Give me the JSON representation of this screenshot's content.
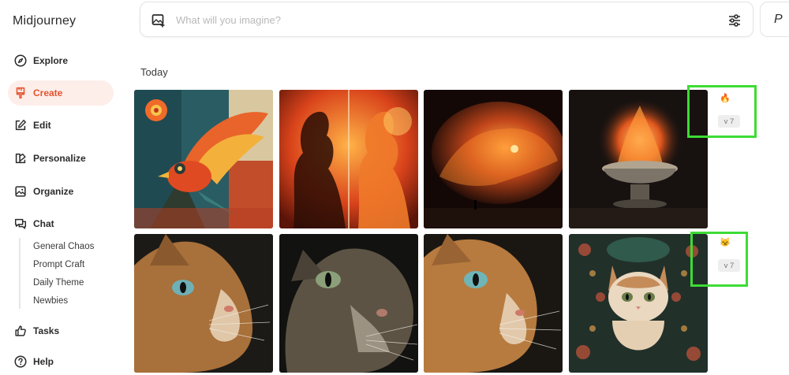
{
  "app": {
    "name": "Midjourney"
  },
  "sidebar": {
    "items": [
      {
        "label": "Explore",
        "icon": "compass-icon"
      },
      {
        "label": "Create",
        "icon": "brush-icon",
        "active": true
      },
      {
        "label": "Edit",
        "icon": "edit-icon"
      },
      {
        "label": "Personalize",
        "icon": "personalize-icon"
      },
      {
        "label": "Organize",
        "icon": "image-icon"
      },
      {
        "label": "Chat",
        "icon": "chat-icon"
      },
      {
        "label": "Tasks",
        "icon": "thumbs-up-icon"
      },
      {
        "label": "Help",
        "icon": "help-icon"
      }
    ],
    "chat_channels": [
      "General Chaos",
      "Prompt Craft",
      "Daily Theme",
      "Newbies"
    ]
  },
  "search": {
    "placeholder": "What will you imagine?"
  },
  "profile": {
    "label": "P"
  },
  "feed": {
    "section_title": "Today",
    "rows": [
      {
        "emoji": "🔥",
        "version": "v 7",
        "images": [
          "phoenix-bird-art",
          "woman-fire-silhouette",
          "fire-wolf-cloud",
          "fire-bowl"
        ]
      },
      {
        "emoji": "😼",
        "version": "v 7",
        "images": [
          "orange-cat-closeup",
          "tabby-cat-closeup",
          "orange-cat-profile",
          "ornamental-kitten"
        ]
      }
    ]
  },
  "colors": {
    "accent": "#e5522e",
    "active_bg": "#fdeeea",
    "highlight": "#3ddc35"
  }
}
